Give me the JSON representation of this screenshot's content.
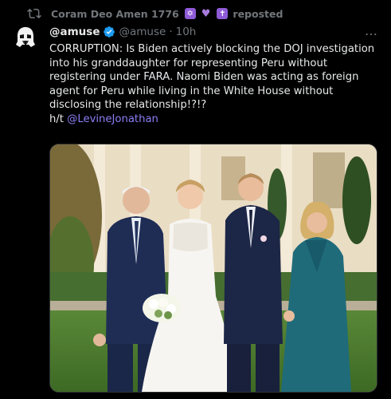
{
  "repost": {
    "reposter_name": "Coram Deo Amen 1776",
    "emoji_star": "✡",
    "emoji_heart": "💜",
    "emoji_cross": "✝",
    "label": "reposted"
  },
  "post": {
    "display_name": "@amuse",
    "handle": "@amuse",
    "separator": "·",
    "time": "10h",
    "more_icon": "…",
    "text_main": "CORRUPTION: Is Biden actively blocking the DOJ investigation into his granddaughter for representing Peru without registering under FARA. Naomi Biden was acting as foreign agent for Peru while living in the White House without disclosing the relationship!?!?",
    "ht_prefix": "h/t ",
    "ht_mention": "@LevineJonathan"
  },
  "colors": {
    "background": "#000000",
    "text": "#e7e9ea",
    "muted": "#71767b",
    "link": "#8b7ef5",
    "verified": "#1d9bf0"
  },
  "icons": {
    "repost": "repost-icon",
    "verified": "verified-badge-icon",
    "avatar": "stormtrooper-avatar"
  },
  "media": {
    "type": "photo",
    "subject": "wedding photo on White House lawn"
  }
}
